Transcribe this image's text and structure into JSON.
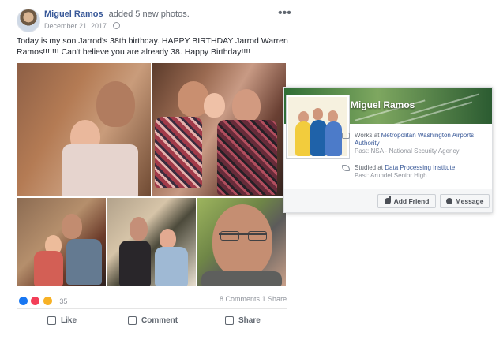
{
  "post": {
    "author": "Miguel Ramos",
    "action": "added 5 new photos.",
    "date": "December 21, 2017",
    "text": "Today is my son Jarrod's 38th birthday. HAPPY BIRTHDAY Jarrod Warren Ramos!!!!!!! Can't believe you are already 38. Happy Birthday!!!!",
    "reaction_count": "35",
    "comments": "8 Comments",
    "shares": "1 Share",
    "actions": [
      "Like",
      "Comment",
      "Share"
    ],
    "more_icon": "more-options-icon",
    "photo_count": 5
  },
  "hover_card": {
    "name": "Miguel Ramos",
    "work_prefix": "Works at ",
    "work_place": "Metropolitan Washington Airports Authority",
    "past_work": "Past: NSA - National Security Agency",
    "study_prefix": "Studied at ",
    "study_place": "Data Processing Institute",
    "past_study": "Past: Arundel Senior High",
    "buttons": {
      "add_friend": "Add Friend",
      "message": "Message"
    }
  },
  "colors": {
    "link": "#385898",
    "facebook_blue": "#1877f2",
    "muted_text": "#616770",
    "divider": "#e5e5e5",
    "card_footer": "#f5f6f7"
  }
}
